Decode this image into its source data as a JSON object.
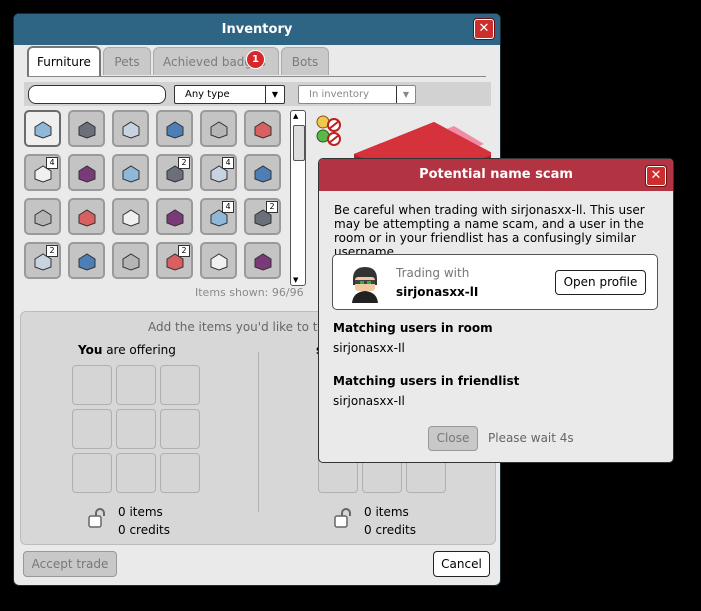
{
  "inventory": {
    "title": "Inventory",
    "tabs": [
      {
        "label": "Furniture"
      },
      {
        "label": "Pets"
      },
      {
        "label": "Achieved badges"
      },
      {
        "label": "Bots"
      }
    ],
    "badge_count": "1",
    "search": {
      "value": "",
      "placeholder": ""
    },
    "type_filter": "Any type",
    "location_filter": "In inventory",
    "items": [
      {
        "icon": "wall-panel-icon",
        "count": ""
      },
      {
        "icon": "door-icon",
        "count": ""
      },
      {
        "icon": "fridge-icon",
        "count": ""
      },
      {
        "icon": "mirror-icon",
        "count": ""
      },
      {
        "icon": "sofa-icon",
        "count": ""
      },
      {
        "icon": "corner-sofa-icon",
        "count": ""
      },
      {
        "icon": "chair-icon",
        "count": "4"
      },
      {
        "icon": "blue-chair-icon",
        "count": ""
      },
      {
        "icon": "blue-sofa-icon",
        "count": ""
      },
      {
        "icon": "cabinet-icon",
        "count": "2"
      },
      {
        "icon": "grate-icon",
        "count": "4"
      },
      {
        "icon": "floor-tile-icon",
        "count": ""
      },
      {
        "icon": "bed-icon",
        "count": ""
      },
      {
        "icon": "table-icon",
        "count": ""
      },
      {
        "icon": "gift-icon",
        "count": ""
      },
      {
        "icon": "flower-icon",
        "count": ""
      },
      {
        "icon": "robot-icon",
        "count": "4"
      },
      {
        "icon": "statue-icon",
        "count": "2"
      },
      {
        "icon": "hanger-icon",
        "count": "2"
      },
      {
        "icon": "crate-icon",
        "count": ""
      },
      {
        "icon": "shoes-icon",
        "count": ""
      },
      {
        "icon": "hanger-gold-icon",
        "count": "2"
      },
      {
        "icon": "chair-red-icon",
        "count": ""
      },
      {
        "icon": "snowman-icon",
        "count": ""
      }
    ],
    "items_shown": "Items shown: 96/96",
    "trade": {
      "hint": "Add the items you'd like to trade in t",
      "you_label": "You",
      "offering_label": " are offering",
      "other_label": "s",
      "my_items": "0 items",
      "my_credits": "0 credits",
      "their_items": "0 items",
      "their_credits": "0 credits"
    },
    "accept_label": "Accept trade",
    "cancel_label": "Cancel"
  },
  "dialog": {
    "title": "Potential name scam",
    "message": "Be careful when trading with sirjonasxx-ll. This user may be attempting a name scam, and a user in the room or in your friendlist has a confusingly similar username.",
    "trading_with_label": "Trading with",
    "trading_with_name": "sirjonasxx-lI",
    "open_profile_label": "Open profile",
    "room_header": "Matching users in room",
    "room_user": "sirjonasxx-Il",
    "friend_header": "Matching users in friendlist",
    "friend_user": "sirjonasxx-Il",
    "close_label": "Close",
    "wait_text": "Please wait 4s"
  },
  "colors": {
    "inventory_header": "#2e6585",
    "dialog_header": "#b23342",
    "close_button": "#cc2e2e",
    "badge": "#d6282b"
  }
}
